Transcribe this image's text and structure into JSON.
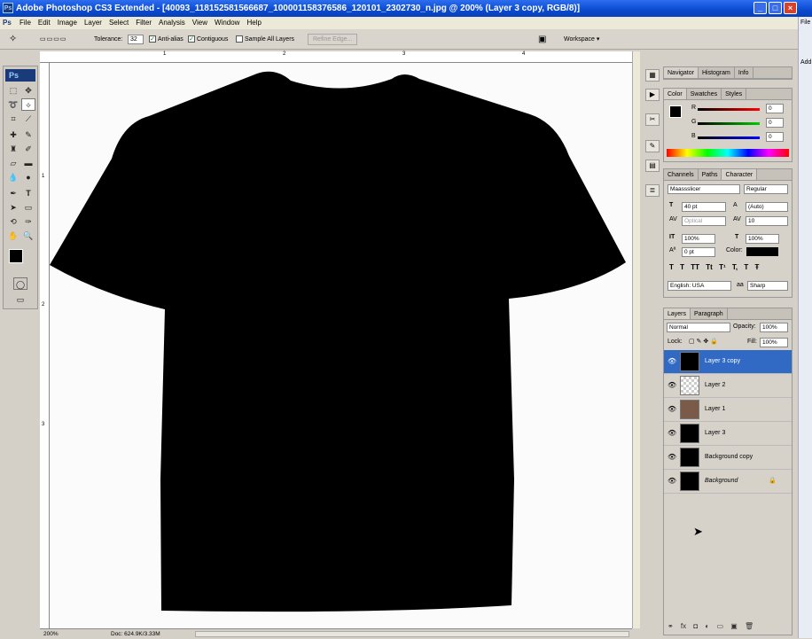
{
  "window": {
    "title": "Adobe Photoshop CS3 Extended - [40093_118152581566687_100001158376586_120101_2302730_n.jpg @ 200% (Layer 3 copy, RGB/8)]",
    "minimize": "_",
    "maximize": "□",
    "close": "×"
  },
  "menu": [
    "File",
    "Edit",
    "Image",
    "Layer",
    "Select",
    "Filter",
    "Analysis",
    "View",
    "Window",
    "Help"
  ],
  "options": {
    "tolerance_label": "Tolerance:",
    "tolerance_value": "32",
    "antialias": "Anti-alias",
    "contiguous": "Contiguous",
    "sample_all": "Sample All Layers",
    "refine": "Refine Edge...",
    "workspace": "Workspace ▾"
  },
  "ruler": {
    "top": [
      "1",
      "2",
      "3",
      "4"
    ],
    "left": [
      "1",
      "2",
      "3"
    ]
  },
  "status": {
    "zoom": "200%",
    "doc": "Doc: 624.9K/3.33M"
  },
  "ps_logo": "Ps",
  "panels": {
    "nav_tabs": [
      "Navigator",
      "Histogram",
      "Info"
    ],
    "color_tabs": [
      "Color",
      "Swatches",
      "Styles"
    ],
    "color": {
      "r_label": "R",
      "g_label": "G",
      "b_label": "B",
      "r": "0",
      "g": "0",
      "b": "0"
    },
    "char_tabs": [
      "Channels",
      "Paths",
      "Character"
    ],
    "character": {
      "font": "Maassslicer",
      "style": "Regular",
      "size": "40 pt",
      "leading": "(Auto)",
      "kerning": "Optical",
      "tracking": "10",
      "vscale": "100%",
      "hscale": "100%",
      "baseline": "0 pt",
      "color_label": "Color:",
      "language": "English: USA",
      "aa": "Sharp",
      "aa_prefix": "aa",
      "styles": [
        "T",
        "T",
        "TT",
        "Tt",
        "T¹",
        "T,",
        "T",
        "Ŧ"
      ]
    },
    "layers_tabs": [
      "Layers",
      "Paragraph"
    ],
    "layers": {
      "blend": "Normal",
      "opacity_label": "Opacity:",
      "opacity": "100%",
      "lock_label": "Lock:",
      "fill_label": "Fill:",
      "fill": "100%",
      "items": [
        {
          "name": "Layer 3 copy"
        },
        {
          "name": "Layer 2"
        },
        {
          "name": "Layer 1"
        },
        {
          "name": "Layer 3"
        },
        {
          "name": "Background copy"
        },
        {
          "name": "Background"
        }
      ]
    }
  },
  "right_strip": {
    "file": "File",
    "add": "Add"
  },
  "colors": {
    "accent": "#316ac5",
    "shirt": "#000000"
  }
}
